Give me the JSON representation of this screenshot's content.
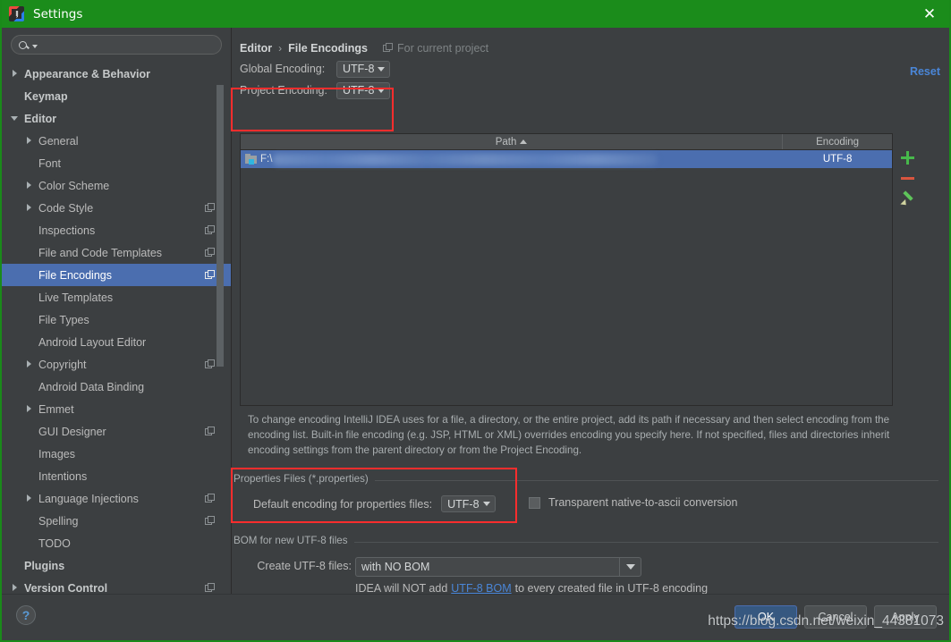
{
  "window": {
    "title": "Settings",
    "logo_icon": "intellij-idea-logo",
    "close_icon": "close-icon",
    "titlebar_color": "#1b8c1b"
  },
  "search": {
    "value": "",
    "placeholder": "",
    "icon": "search-icon",
    "dropdown_icon": "chevron-down-icon"
  },
  "sidebar": {
    "items": [
      {
        "label": "Appearance & Behavior",
        "arrow": "right",
        "indent": 0,
        "bold": true,
        "selected": false,
        "project_icon": false
      },
      {
        "label": "Keymap",
        "arrow": "none",
        "indent": 0,
        "bold": true,
        "selected": false,
        "project_icon": false
      },
      {
        "label": "Editor",
        "arrow": "down",
        "indent": 0,
        "bold": true,
        "selected": false,
        "project_icon": false
      },
      {
        "label": "General",
        "arrow": "right",
        "indent": 1,
        "bold": false,
        "selected": false,
        "project_icon": false
      },
      {
        "label": "Font",
        "arrow": "none",
        "indent": 1,
        "bold": false,
        "selected": false,
        "project_icon": false
      },
      {
        "label": "Color Scheme",
        "arrow": "right",
        "indent": 1,
        "bold": false,
        "selected": false,
        "project_icon": false
      },
      {
        "label": "Code Style",
        "arrow": "right",
        "indent": 1,
        "bold": false,
        "selected": false,
        "project_icon": true
      },
      {
        "label": "Inspections",
        "arrow": "none",
        "indent": 1,
        "bold": false,
        "selected": false,
        "project_icon": true
      },
      {
        "label": "File and Code Templates",
        "arrow": "none",
        "indent": 1,
        "bold": false,
        "selected": false,
        "project_icon": true
      },
      {
        "label": "File Encodings",
        "arrow": "none",
        "indent": 1,
        "bold": false,
        "selected": true,
        "project_icon": true
      },
      {
        "label": "Live Templates",
        "arrow": "none",
        "indent": 1,
        "bold": false,
        "selected": false,
        "project_icon": false
      },
      {
        "label": "File Types",
        "arrow": "none",
        "indent": 1,
        "bold": false,
        "selected": false,
        "project_icon": false
      },
      {
        "label": "Android Layout Editor",
        "arrow": "none",
        "indent": 1,
        "bold": false,
        "selected": false,
        "project_icon": false
      },
      {
        "label": "Copyright",
        "arrow": "right",
        "indent": 1,
        "bold": false,
        "selected": false,
        "project_icon": true
      },
      {
        "label": "Android Data Binding",
        "arrow": "none",
        "indent": 1,
        "bold": false,
        "selected": false,
        "project_icon": false
      },
      {
        "label": "Emmet",
        "arrow": "right",
        "indent": 1,
        "bold": false,
        "selected": false,
        "project_icon": false
      },
      {
        "label": "GUI Designer",
        "arrow": "none",
        "indent": 1,
        "bold": false,
        "selected": false,
        "project_icon": true
      },
      {
        "label": "Images",
        "arrow": "none",
        "indent": 1,
        "bold": false,
        "selected": false,
        "project_icon": false
      },
      {
        "label": "Intentions",
        "arrow": "none",
        "indent": 1,
        "bold": false,
        "selected": false,
        "project_icon": false
      },
      {
        "label": "Language Injections",
        "arrow": "right",
        "indent": 1,
        "bold": false,
        "selected": false,
        "project_icon": true
      },
      {
        "label": "Spelling",
        "arrow": "none",
        "indent": 1,
        "bold": false,
        "selected": false,
        "project_icon": true
      },
      {
        "label": "TODO",
        "arrow": "none",
        "indent": 1,
        "bold": false,
        "selected": false,
        "project_icon": false
      },
      {
        "label": "Plugins",
        "arrow": "none",
        "indent": 0,
        "bold": true,
        "selected": false,
        "project_icon": false
      },
      {
        "label": "Version Control",
        "arrow": "right",
        "indent": 0,
        "bold": true,
        "selected": false,
        "project_icon": true
      }
    ]
  },
  "main": {
    "breadcrumb": {
      "parent": "Editor",
      "separator": "›",
      "current": "File Encodings"
    },
    "scope_note": {
      "label": "For current project",
      "icon": "project-scope-icon"
    },
    "reset_label": "Reset",
    "global_encoding": {
      "label": "Global Encoding:",
      "value": "UTF-8"
    },
    "project_encoding": {
      "label": "Project Encoding:",
      "value": "UTF-8"
    },
    "table": {
      "columns": [
        "Path",
        "Encoding"
      ],
      "sort_column": "Path",
      "sort_direction": "asc",
      "rows": [
        {
          "path_prefix": "F:\\",
          "path_redacted": true,
          "encoding": "UTF-8",
          "selected": true,
          "icon": "folder-icon"
        }
      ]
    },
    "table_tools": [
      {
        "name": "add-path-button",
        "icon": "plus-icon",
        "color": "#47b84b"
      },
      {
        "name": "remove-path-button",
        "icon": "minus-icon",
        "color": "#d9553f"
      },
      {
        "name": "edit-path-button",
        "icon": "pencil-icon",
        "color": "#5ec45a"
      }
    ],
    "description": "To change encoding IntelliJ IDEA uses for a file, a directory, or the entire project, add its path if necessary and then select encoding from the encoding list. Built-in file encoding (e.g. JSP, HTML or XML) overrides encoding you specify here. If not specified, files and directories inherit encoding settings from the parent directory or from the Project Encoding.",
    "properties_group": {
      "title": "Properties Files (*.properties)",
      "default_encoding_label": "Default encoding for properties files:",
      "default_encoding_value": "UTF-8",
      "transparent_label": "Transparent native-to-ascii conversion",
      "transparent_checked": false
    },
    "bom_group": {
      "title": "BOM for new UTF-8 files",
      "create_label": "Create UTF-8 files:",
      "create_value": "with NO BOM",
      "note_prefix": "IDEA will NOT add",
      "note_link": "UTF-8 BOM",
      "note_suffix": "to every created file in UTF-8 encoding"
    },
    "highlight_color": "#ff2d2d"
  },
  "footer": {
    "help_label": "?",
    "buttons": [
      {
        "label": "OK",
        "primary": true
      },
      {
        "label": "Cancel",
        "primary": false
      },
      {
        "label": "Apply",
        "primary": false
      }
    ]
  },
  "watermark": {
    "text": "https://blog.csdn.net/weixin_44381073"
  }
}
